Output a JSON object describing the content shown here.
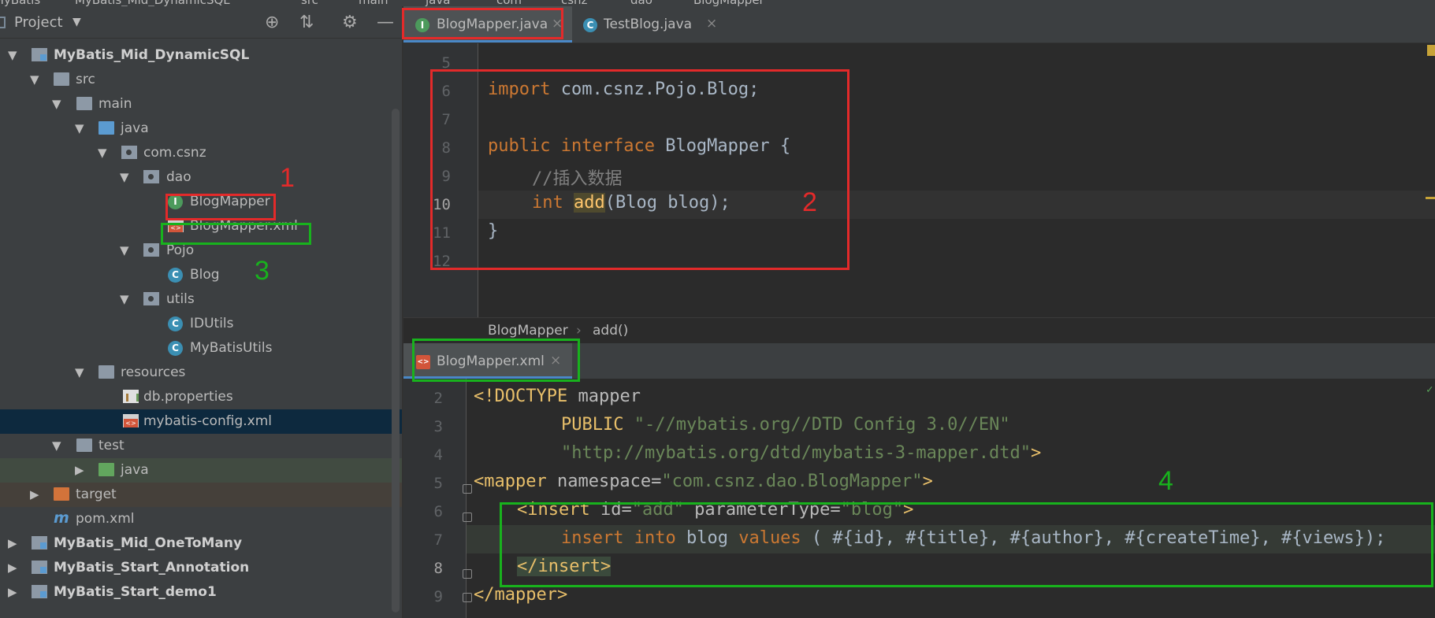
{
  "topbar": {
    "crumbs": [
      "MyBatis",
      "MyBatis_Mid_DynamicSQL",
      "src",
      "main",
      "java",
      "com",
      "csnz",
      "dao",
      "BlogMapper"
    ]
  },
  "project_panel": {
    "title": "Project",
    "tree": [
      {
        "label": "MyBatis_Mid_DynamicSQL",
        "icon": "module-icon",
        "bold": true
      },
      {
        "label": "src",
        "icon": "folder-icon"
      },
      {
        "label": "main",
        "icon": "folder-icon"
      },
      {
        "label": "java",
        "icon": "source-folder-icon"
      },
      {
        "label": "com.csnz",
        "icon": "package-icon"
      },
      {
        "label": "dao",
        "icon": "package-icon"
      },
      {
        "label": "BlogMapper",
        "icon": "interface-icon"
      },
      {
        "label": "BlogMapper.xml",
        "icon": "xml-file-icon"
      },
      {
        "label": "Pojo",
        "icon": "package-icon"
      },
      {
        "label": "Blog",
        "icon": "class-icon"
      },
      {
        "label": "utils",
        "icon": "package-icon"
      },
      {
        "label": "IDUtils",
        "icon": "class-icon"
      },
      {
        "label": "MyBatisUtils",
        "icon": "class-icon"
      },
      {
        "label": "resources",
        "icon": "resources-folder-icon"
      },
      {
        "label": "db.properties",
        "icon": "properties-file-icon"
      },
      {
        "label": "mybatis-config.xml",
        "icon": "xml-file-icon"
      },
      {
        "label": "test",
        "icon": "folder-icon"
      },
      {
        "label": "java",
        "icon": "test-folder-icon"
      },
      {
        "label": "target",
        "icon": "excluded-folder-icon"
      },
      {
        "label": "pom.xml",
        "icon": "maven-icon"
      },
      {
        "label": "MyBatis_Mid_OneToMany",
        "icon": "module-icon",
        "bold": true
      },
      {
        "label": "MyBatis_Start_Annotation",
        "icon": "module-icon",
        "bold": true
      },
      {
        "label": "MyBatis_Start_demo1",
        "icon": "module-icon",
        "bold": true
      }
    ]
  },
  "editor_top": {
    "tabs": [
      {
        "label": "BlogMapper.java",
        "icon": "interface-icon",
        "active": true
      },
      {
        "label": "TestBlog.java",
        "icon": "class-icon",
        "active": false
      }
    ],
    "line_numbers": [
      "5",
      "6",
      "7",
      "8",
      "9",
      "10",
      "11",
      "12"
    ],
    "code": {
      "l6_kw": "import",
      "l6_rest": " com.csnz.Pojo.Blog;",
      "l8_kw1": "public",
      "l8_kw2": "interface",
      "l8_rest": " BlogMapper {",
      "l9_comment": "//插入数据",
      "l10_kw": "int",
      "l10_method": "add",
      "l10_rest": "(Blog blog);",
      "l11": "}"
    },
    "breadcrumb": [
      "BlogMapper",
      "add()"
    ]
  },
  "editor_bottom": {
    "tabs": [
      {
        "label": "BlogMapper.xml",
        "icon": "xml-file-icon",
        "active": true
      }
    ],
    "line_numbers": [
      "2",
      "3",
      "4",
      "5",
      "6",
      "7",
      "8",
      "9"
    ],
    "code": {
      "l2_a": "<!DOCTYPE",
      "l2_b": " mapper",
      "l3_kw": "PUBLIC",
      "l3_str": "\"-//mybatis.org//DTD Config 3.0//EN\"",
      "l4_str": "\"http://mybatis.org/dtd/mybatis-3-mapper.dtd\"",
      "l4_end": ">",
      "l5_tag": "<mapper",
      "l5_attr": " namespace=",
      "l5_val": "\"com.csnz.dao.BlogMapper\"",
      "l5_end": ">",
      "l6_tag": "<insert",
      "l6_attr1": " id=",
      "l6_val1": "\"add\"",
      "l6_attr2": " parameterType=",
      "l6_val2": "\"blog\"",
      "l6_end": ">",
      "l7_kw1": "insert",
      "l7_kw2": "into",
      "l7_mid": " blog ",
      "l7_kw3": "values",
      "l7_rest": " ( #{id}, #{title}, #{author}, #{createTime}, #{views});",
      "l8_tag": "</insert>",
      "l9_tag": "</mapper>"
    }
  },
  "annotations": [
    "1",
    "2",
    "3",
    "4"
  ],
  "colors": {
    "red": "#e32a2a",
    "green": "#18b21d",
    "keyword": "#cc7832",
    "string": "#6a8759",
    "tag": "#e8bf6a"
  }
}
